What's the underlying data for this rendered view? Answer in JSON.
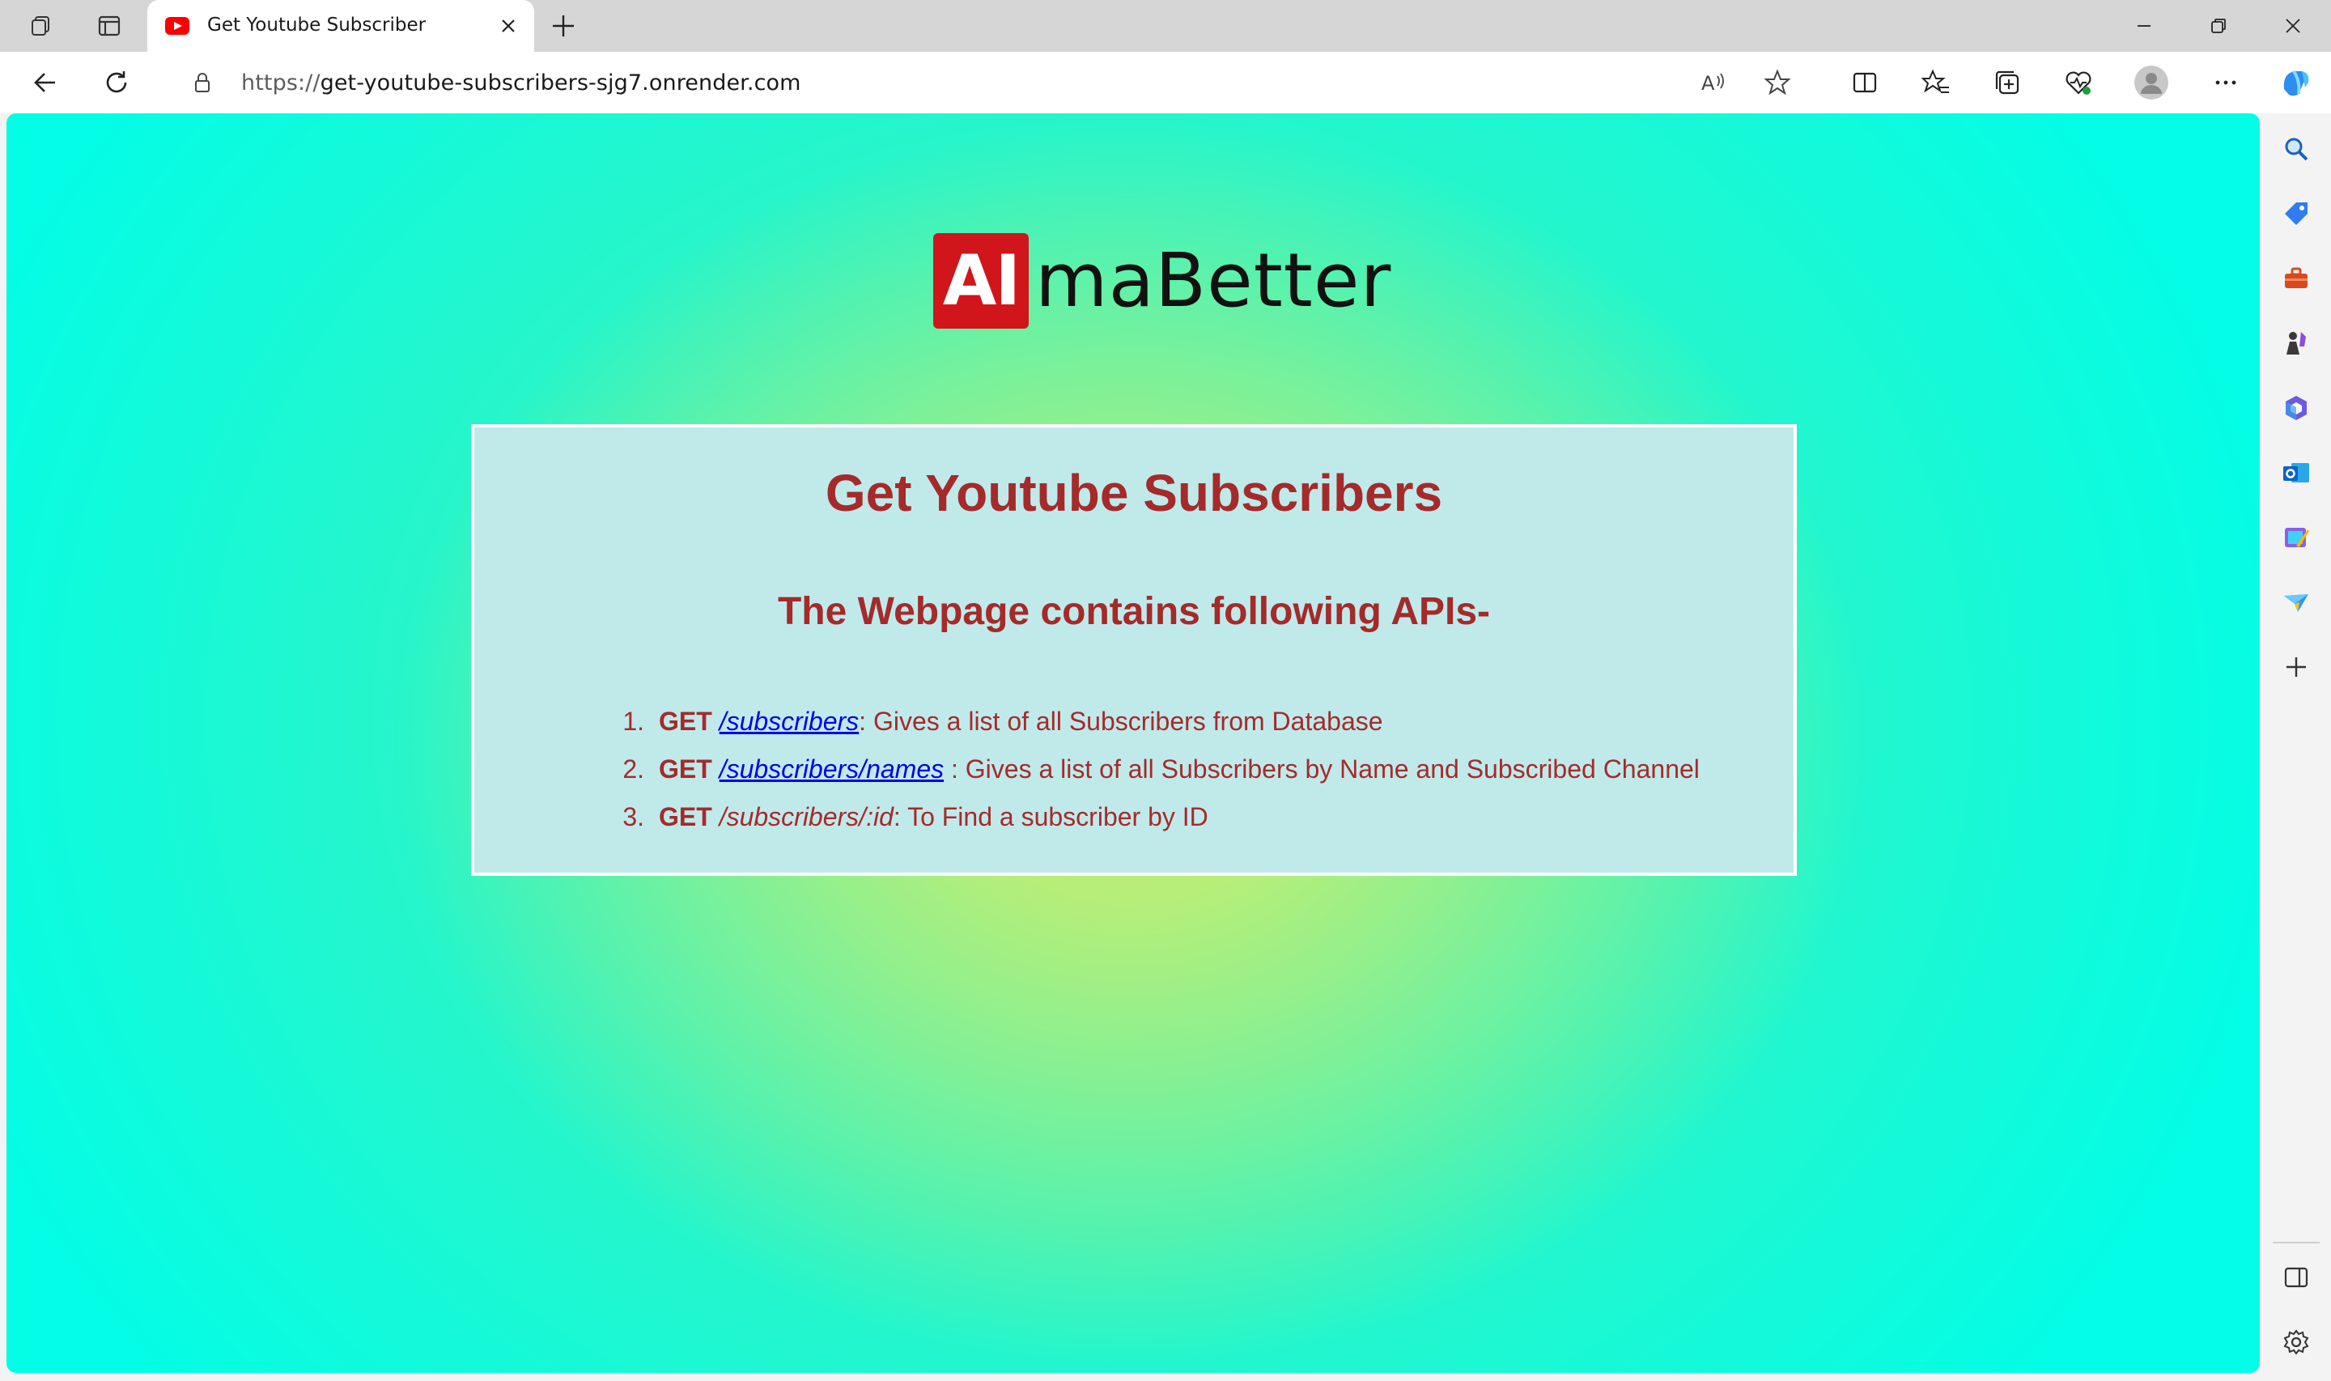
{
  "browser": {
    "tab": {
      "title": "Get Youtube Subscriber",
      "favicon": "youtube-favicon"
    },
    "address_bar": {
      "url_protocol": "https://",
      "url_host": "get-youtube-subscribers-sjg7.onrender.com"
    },
    "toolbar_icons": [
      "back-icon",
      "refresh-icon",
      "lock-icon",
      "read-aloud-icon",
      "favorite-star-icon",
      "split-screen-icon",
      "favorites-icon",
      "collections-icon",
      "browser-essentials-icon",
      "profile-avatar-icon",
      "more-icon",
      "copilot-icon"
    ],
    "sidebar_icons": [
      "search-icon",
      "shopping-tag-icon",
      "tools-icon",
      "games-icon",
      "microsoft-365-icon",
      "outlook-icon",
      "designer-icon",
      "drop-icon",
      "add-icon",
      "hide-sidebar-icon",
      "settings-icon"
    ]
  },
  "page": {
    "logo": {
      "badge_text": "AI",
      "text": "maBetter",
      "badge_color": "#d0161b"
    },
    "heading": "Get Youtube Subscribers",
    "subheading": "The Webpage contains following APIs-",
    "apis": [
      {
        "num": "1.",
        "method": "GET",
        "path": "/subscribers",
        "link": true,
        "desc": ": Gives a list of all Subscribers from Database"
      },
      {
        "num": "2.",
        "method": "GET",
        "path": "/subscribers/names",
        "link": true,
        "desc": " : Gives a list of all Subscribers by Name and Subscribed Channel"
      },
      {
        "num": "3.",
        "method": "GET",
        "path": "/subscribers/:id",
        "link": false,
        "desc": ": To Find a subscriber by ID"
      }
    ],
    "colors": {
      "text": "#a52a2a",
      "link": "#0000ee",
      "card_bg": "#c0eaea"
    }
  }
}
